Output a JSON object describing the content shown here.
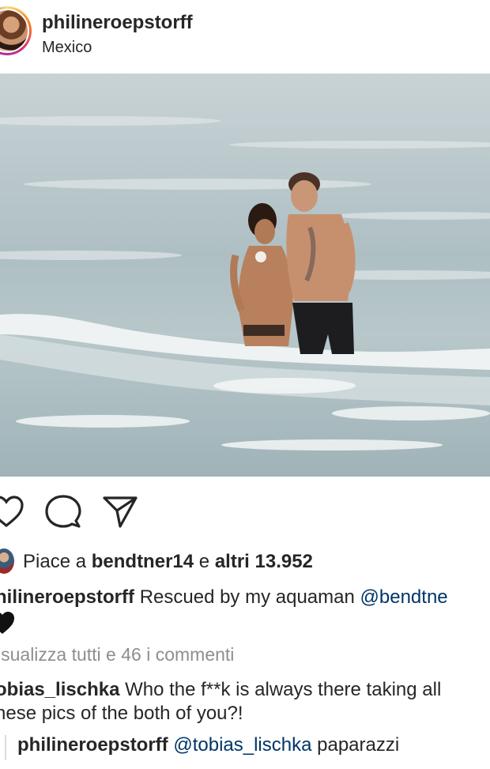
{
  "post": {
    "username": "philineroepstorff",
    "location": "Mexico"
  },
  "actions": {
    "like_icon": "heart-outline-icon",
    "comment_icon": "comment-bubble-icon",
    "share_icon": "paper-plane-icon"
  },
  "likes": {
    "prefix": "Piace a",
    "user": "bendtner14",
    "connector": "e",
    "others": "altri 13.952"
  },
  "caption": {
    "username": "hilineroepstorff",
    "text": "Rescued by my aquaman",
    "mention": "@bendtne",
    "emoji": "black-heart-icon"
  },
  "view_comments": "isualizza tutti e 46 i commenti",
  "comments": [
    {
      "username": "obias_lischka",
      "text_line1": "Who the f**k is always there taking all",
      "text_line2": "nese pics of the both of you?!"
    }
  ],
  "reply": {
    "username": "philineroepstorff",
    "mention": "@tobias_lischka",
    "text": "paparazzi"
  }
}
